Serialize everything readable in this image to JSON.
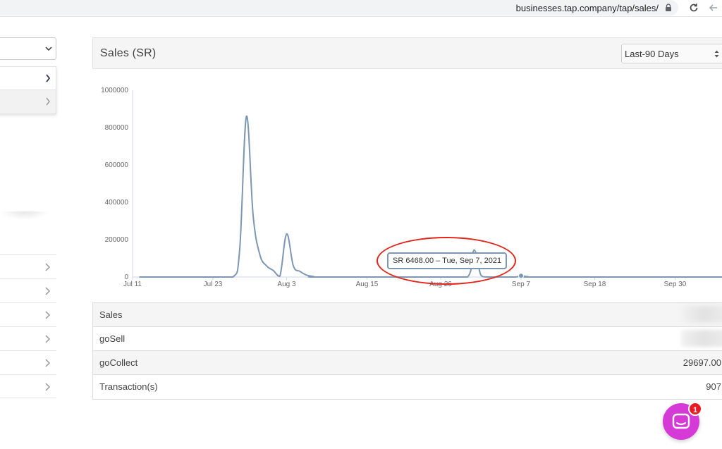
{
  "browser": {
    "url": "businesses.tap.company/tap/sales/"
  },
  "panel": {
    "title": "Sales (SR)",
    "range": {
      "selected": "Last-90 Days"
    }
  },
  "tooltip": {
    "text": "SR 6468.00 – Tue, Sep 7, 2021"
  },
  "summary": {
    "rows": [
      {
        "label": "Sales",
        "value": ""
      },
      {
        "label": "goSell",
        "value": ""
      },
      {
        "label": "goCollect",
        "value": "29697.00"
      },
      {
        "label": "Transaction(s)",
        "value": "907"
      }
    ]
  },
  "chat": {
    "badge_count": "1"
  },
  "colors": {
    "line": "#7d97b3",
    "annotation": "#e0251b",
    "chat": "#d63ad6",
    "badge": "#e81b23"
  },
  "chart_data": {
    "type": "line",
    "title": "",
    "xlabel": "",
    "ylabel": "",
    "ylim": [
      0,
      1000000
    ],
    "y_ticks": [
      "1000000",
      "800000",
      "600000",
      "400000",
      "200000",
      "0"
    ],
    "x_ticks": [
      "Jul 11",
      "Jul 23",
      "Aug 3",
      "Aug 15",
      "Aug 26",
      "Sep 7",
      "Sep 18",
      "Sep 30"
    ],
    "grid": false,
    "series": [
      {
        "points": [
          {
            "x": "2021-07-12",
            "y": 0
          },
          {
            "x": "2021-07-23",
            "y": 0
          },
          {
            "x": "2021-07-26",
            "y": 0
          },
          {
            "x": "2021-07-27",
            "y": 150000
          },
          {
            "x": "2021-07-28",
            "y": 860000
          },
          {
            "x": "2021-07-29",
            "y": 330000
          },
          {
            "x": "2021-07-30",
            "y": 120000
          },
          {
            "x": "2021-07-31",
            "y": 60000
          },
          {
            "x": "2021-08-01",
            "y": 35000
          },
          {
            "x": "2021-08-02",
            "y": 5000
          },
          {
            "x": "2021-08-03",
            "y": 230000
          },
          {
            "x": "2021-08-04",
            "y": 60000
          },
          {
            "x": "2021-08-05",
            "y": 30000
          },
          {
            "x": "2021-08-06",
            "y": 10000
          },
          {
            "x": "2021-08-07",
            "y": 3000
          },
          {
            "x": "2021-08-08",
            "y": 0
          },
          {
            "x": "2021-08-26",
            "y": 0
          },
          {
            "x": "2021-08-30",
            "y": 0
          },
          {
            "x": "2021-08-31",
            "y": 145000
          },
          {
            "x": "2021-09-01",
            "y": 10000
          },
          {
            "x": "2021-09-02",
            "y": 0
          },
          {
            "x": "2021-09-06",
            "y": 0
          },
          {
            "x": "2021-09-07",
            "y": 6468
          },
          {
            "x": "2021-09-08",
            "y": 2000
          },
          {
            "x": "2021-09-10",
            "y": 0
          },
          {
            "x": "2021-10-10",
            "y": 0
          }
        ]
      }
    ],
    "highlight": {
      "x": "2021-09-07",
      "y": 6468
    }
  }
}
